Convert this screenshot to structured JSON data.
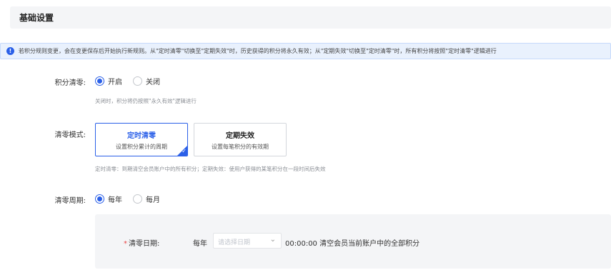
{
  "section": {
    "title": "基础设置"
  },
  "notice": {
    "icon": "info-icon",
    "text": "若积分规则变更，会在变更保存后开始执行新规则。从\"定时清零\"切换至\"定期失效\"时，历史获得的积分将永久有效；从\"定期失效\"切换至\"定时清零\"时，所有积分将按照\"定时清零\"逻辑进行"
  },
  "points_clear": {
    "label": "积分清零:",
    "options": [
      {
        "label": "开启",
        "checked": true
      },
      {
        "label": "关闭",
        "checked": false
      }
    ],
    "hint": "关闭时，积分将仍按照\"永久有效\"逻辑进行"
  },
  "clear_mode": {
    "label": "清零模式:",
    "cards": [
      {
        "title": "定时清零",
        "subtitle": "设置积分累计的周期",
        "active": true
      },
      {
        "title": "定期失效",
        "subtitle": "设置每笔积分的有效期",
        "active": false
      }
    ],
    "hint": "定时清零：到期清空会员账户中的所有积分；定期失效：使用户获得的某笔积分在一段时间后失效"
  },
  "clear_cycle": {
    "label": "清零周期:",
    "options": [
      {
        "label": "每年",
        "checked": true
      },
      {
        "label": "每月",
        "checked": false
      }
    ]
  },
  "clear_date": {
    "required_mark": "*",
    "label": "清零日期:",
    "prefix": "每年",
    "select_placeholder": "请选择日期",
    "suffix": "00:00:00 清空会员当前账户中的全部积分"
  },
  "colors": {
    "primary": "#2b60e8",
    "required": "#e84545",
    "panel_bg": "#f4f5f7"
  }
}
